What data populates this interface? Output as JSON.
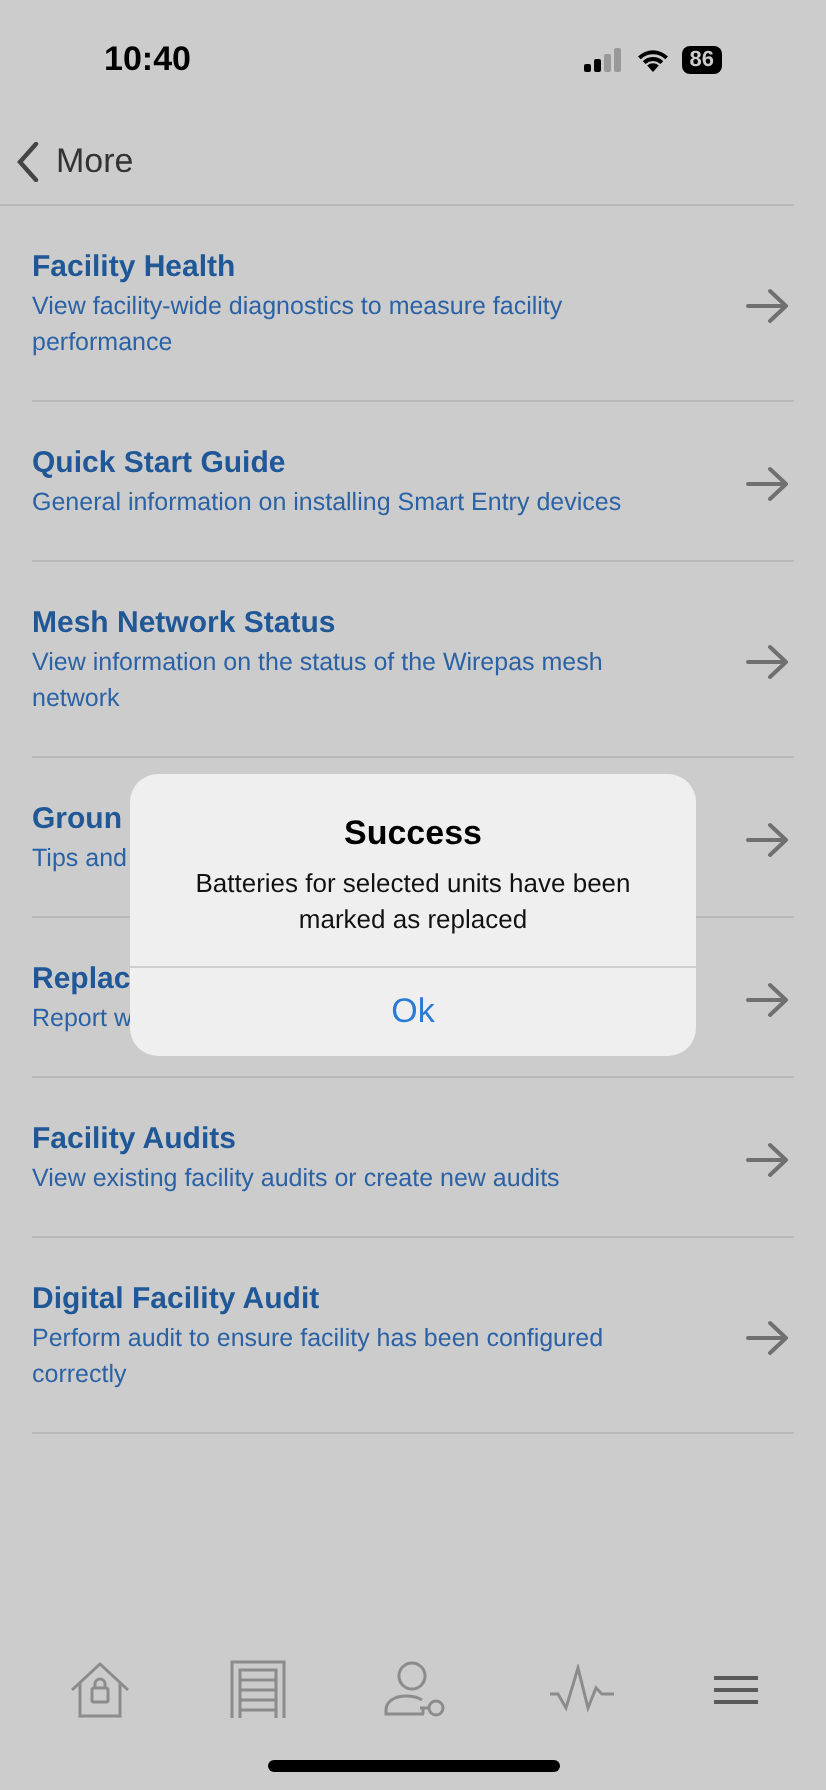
{
  "status_bar": {
    "time": "10:40",
    "battery": "86"
  },
  "nav": {
    "back_label": "More"
  },
  "items": [
    {
      "title": "Facility Health",
      "description": "View facility-wide diagnostics to measure facility performance"
    },
    {
      "title": "Quick Start Guide",
      "description": "General information on installing Smart Entry devices"
    },
    {
      "title": "Mesh Network Status",
      "description": "View information on the status of the Wirepas mesh network"
    },
    {
      "title": "Groun",
      "description": "Tips and"
    },
    {
      "title": "Replac",
      "description": "Report w"
    },
    {
      "title": "Facility Audits",
      "description": "View existing facility audits or create new audits"
    },
    {
      "title": "Digital Facility Audit",
      "description": "Perform audit to ensure facility has been configured correctly"
    }
  ],
  "dialog": {
    "title": "Success",
    "message": "Batteries for selected units have been marked as replaced",
    "button": "Ok"
  },
  "tabs": [
    {
      "kind": "home",
      "selected": false
    },
    {
      "kind": "door",
      "selected": false
    },
    {
      "kind": "user-key",
      "selected": false
    },
    {
      "kind": "pulse",
      "selected": false
    },
    {
      "kind": "menu",
      "selected": true
    }
  ]
}
